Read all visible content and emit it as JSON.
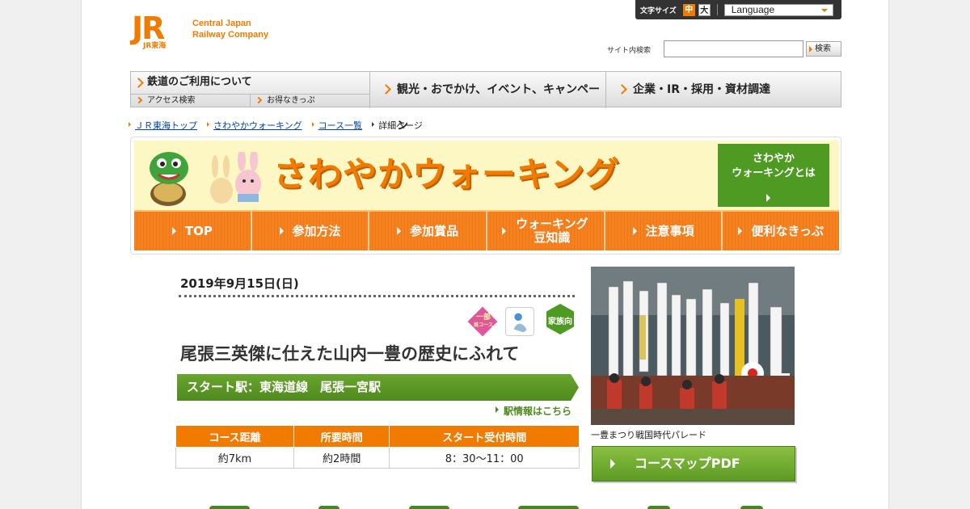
{
  "header": {
    "logo_jr": "JR",
    "logo_jr_sub": "JR東海",
    "logo_text_line1": "Central Japan",
    "logo_text_line2": "Railway Company",
    "font_size_label": "文字サイズ",
    "font_size_mid": "中",
    "font_size_large": "大",
    "language_select": "Language",
    "site_search_label": "サイト内検索",
    "search_value": "",
    "search_button": "検索"
  },
  "global_nav": {
    "railway_main": "鉄道のご利用について",
    "railway_sub1": "アクセス検索",
    "railway_sub2": "お得なきっぷ",
    "tourism": "観光・おでかけ、イベント、キャンペーン",
    "corporate": "企業・IR・採用・資材調達"
  },
  "breadcrumb": {
    "items": [
      "ＪＲ東海トップ",
      "さわやかウォーキング",
      "コース一覧"
    ],
    "current": "詳細ページ"
  },
  "banner": {
    "title": "さわやかウォーキング",
    "about_line1": "さわやか",
    "about_line2": "ウォーキングとは",
    "nav": [
      {
        "label": "TOP"
      },
      {
        "label": "参加方法"
      },
      {
        "label": "参加賞品"
      },
      {
        "label": "ウォーキング豆知識"
      },
      {
        "label": "注意事項"
      },
      {
        "label": "便利なきっぷ"
      }
    ]
  },
  "course": {
    "date": "2019年9月15日(日)",
    "badge_partial_line1": "一部",
    "badge_partial_line2": "既コース",
    "badge_family": "家族向",
    "title": "尾張三英傑に仕えた山内一豊の歴史にふれて",
    "start_station": "スタート駅：東海道線　尾張一宮駅",
    "station_info_link": "駅情報はこちら",
    "table_headers": [
      "コース距離",
      "所要時間",
      "スタート受付時間"
    ],
    "table_values": [
      "約7km",
      "約2時間",
      "8：30～11：00"
    ],
    "photo_caption": "一豊まつり戦国時代パレード",
    "course_map_button": "コースマップPDF"
  },
  "colors": {
    "accent_orange": "#f07b00",
    "nav_orange": "#f58220",
    "green": "#4e9a22",
    "banner_yellow": "#fdf7c4"
  }
}
